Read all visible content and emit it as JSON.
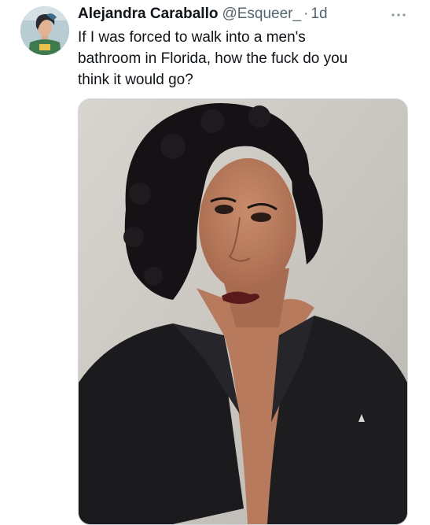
{
  "tweet": {
    "author": {
      "display_name": "Alejandra Caraballo",
      "handle": "@Esqueer_",
      "avatar_icon": "profile-avatar"
    },
    "separator": "·",
    "timestamp": "1d",
    "more_icon": "more-horizontal-icon",
    "text": "If I was forced to walk into a men's\nbathroom in Florida, how the fuck do you\nthink it would go?",
    "media": {
      "type": "photo"
    }
  },
  "colors": {
    "primary_text": "#0f1419",
    "secondary_text": "#536471",
    "border": "#cfd9de",
    "background": "#ffffff"
  }
}
